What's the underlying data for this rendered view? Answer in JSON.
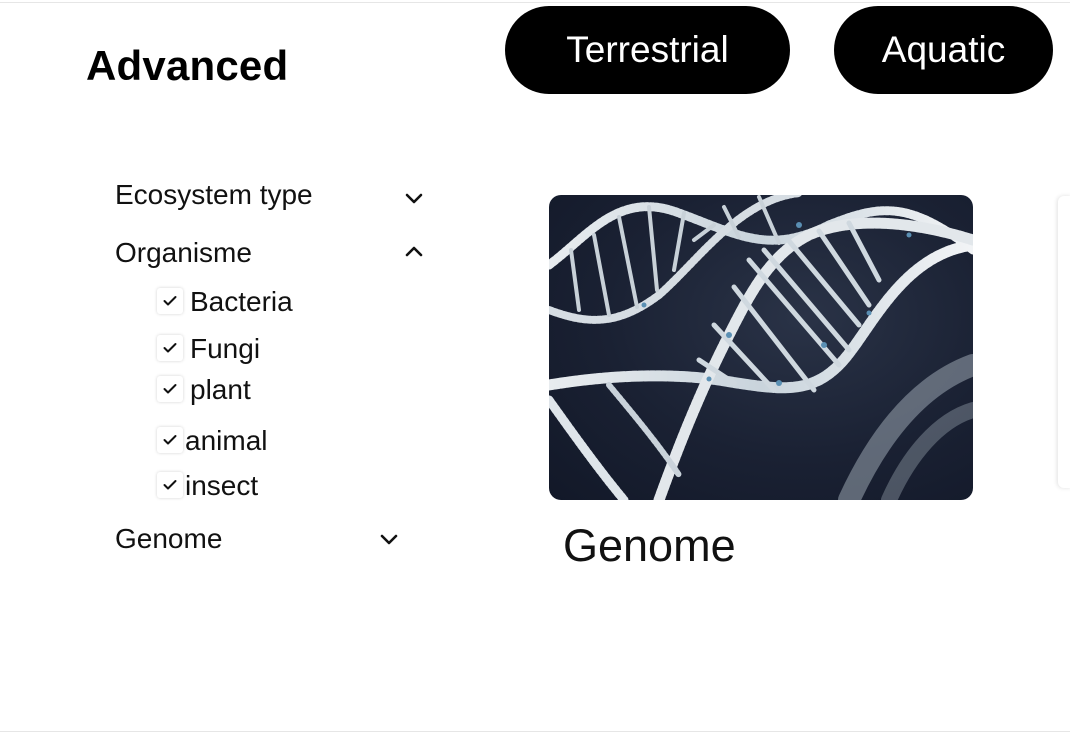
{
  "page": {
    "title": "Advanced"
  },
  "category_pills": [
    {
      "label": "Terrestrial"
    },
    {
      "label": "Aquatic"
    }
  ],
  "filters": {
    "ecosystem_type": {
      "label": "Ecosystem type",
      "expanded": false,
      "icon": "chevron-down-icon"
    },
    "organisme": {
      "label": "Organisme",
      "expanded": true,
      "icon": "chevron-up-icon",
      "options": [
        {
          "label": "Bacteria",
          "checked": true
        },
        {
          "label": "Fungi",
          "checked": true
        },
        {
          "label": "plant",
          "checked": true
        },
        {
          "label": "animal",
          "checked": true
        },
        {
          "label": "insect",
          "checked": true
        }
      ]
    },
    "genome": {
      "label": "Genome",
      "expanded": false,
      "icon": "chevron-down-icon"
    }
  },
  "cards": [
    {
      "title": "Genome",
      "image": "dna-double-helix-image"
    }
  ],
  "colors": {
    "pill_bg": "#000000",
    "pill_text": "#ffffff",
    "image_bg": "#1a2133"
  }
}
